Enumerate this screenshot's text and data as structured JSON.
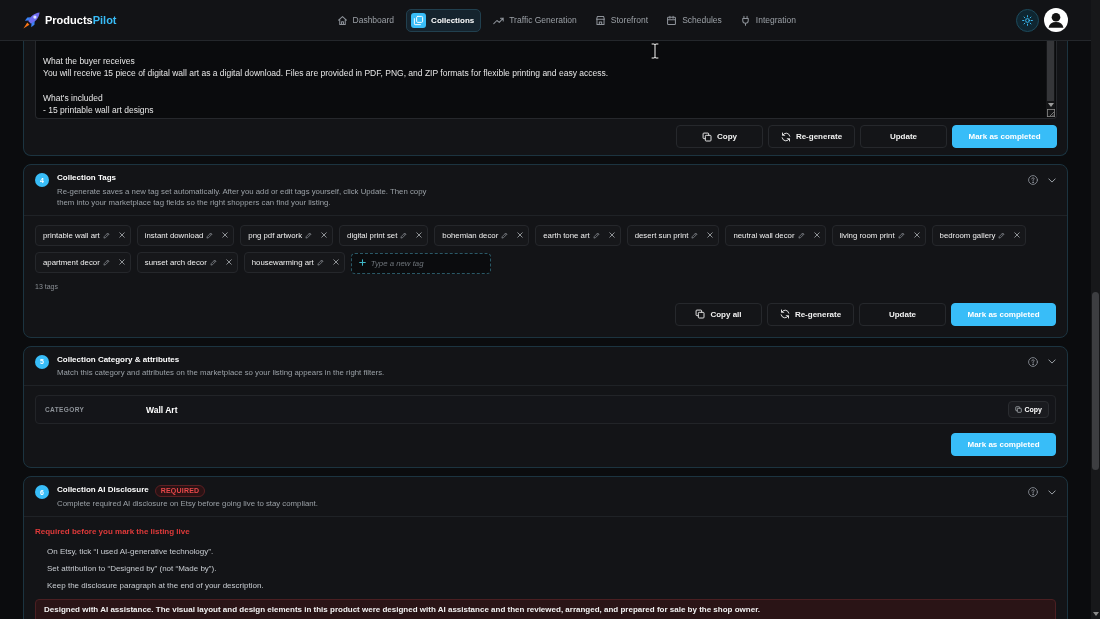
{
  "brand": {
    "name": "Products",
    "name_accent": "Pilot"
  },
  "nav": {
    "items": [
      {
        "label": "Dashboard",
        "selected": false
      },
      {
        "label": "Collections",
        "selected": true
      },
      {
        "label": "Traffic Generation",
        "selected": false
      },
      {
        "label": "Storefront",
        "selected": false
      },
      {
        "label": "Schedules",
        "selected": false
      },
      {
        "label": "Integration",
        "selected": false
      }
    ]
  },
  "sections": [
    {
      "kind": "description",
      "paragraphs": [
        [
          "What the buyer receives",
          "You will receive 15 piece of digital wall art as a digital download. Files are provided in PDF, PNG, and ZIP formats for flexible printing and easy access."
        ],
        [
          "What's included",
          "- 15 printable wall art designs"
        ]
      ],
      "buttons": [
        {
          "kind": "copy",
          "label": "Copy"
        },
        {
          "kind": "regenerate",
          "label": "Re-generate"
        },
        {
          "kind": "update",
          "label": "Update"
        },
        {
          "kind": "complete",
          "label": "Mark as completed"
        }
      ]
    },
    {
      "kind": "tags",
      "number": "4",
      "title": "Collection Tags",
      "description": "Re-generate saves a new tag set automatically. After you add or edit tags yourself, click Update. Then copy them into your marketplace tag fields so the right shoppers can find your listing.",
      "tags": [
        "printable wall art",
        "instant download",
        "png pdf artwork",
        "digital print set",
        "bohemian decor",
        "earth tone art",
        "desert sun print",
        "neutral wall decor",
        "living room print",
        "bedroom gallery",
        "apartment decor",
        "sunset arch decor",
        "housewarming art"
      ],
      "new_tag": {
        "placeholder": "Type a new tag"
      },
      "count": "13 tags",
      "buttons": [
        {
          "kind": "copy",
          "label": "Copy all"
        },
        {
          "kind": "regenerate",
          "label": "Re-generate"
        },
        {
          "kind": "update",
          "label": "Update"
        },
        {
          "kind": "complete",
          "label": "Mark as completed"
        }
      ]
    },
    {
      "kind": "category",
      "number": "5",
      "title": "Collection Category & attributes",
      "description": "Match this category and attributes on the marketplace so your listing appears in the right filters.",
      "attributes": [
        {
          "label": "CATEGORY",
          "value": "Wall Art",
          "action": "Copy"
        }
      ],
      "buttons": [
        {
          "kind": "complete",
          "label": "Mark as completed"
        }
      ]
    },
    {
      "kind": "disclosure",
      "number": "6",
      "title": "Collection AI Disclosure",
      "badge": "REQUIRED",
      "description": "Complete required AI disclosure on Etsy before going live to stay compliant.",
      "alert": "Required before you mark the listing live",
      "steps": [
        "On Etsy, tick “I used AI-generative technology”.",
        "Set attribution to “Designed by” (not “Made by”).",
        "Keep the disclosure paragraph at the end of your description."
      ],
      "disclosure_text": "Designed with AI assistance. The visual layout and design elements in this product were designed with AI assistance and then reviewed, arranged, and prepared for sale by the shop owner."
    }
  ]
}
